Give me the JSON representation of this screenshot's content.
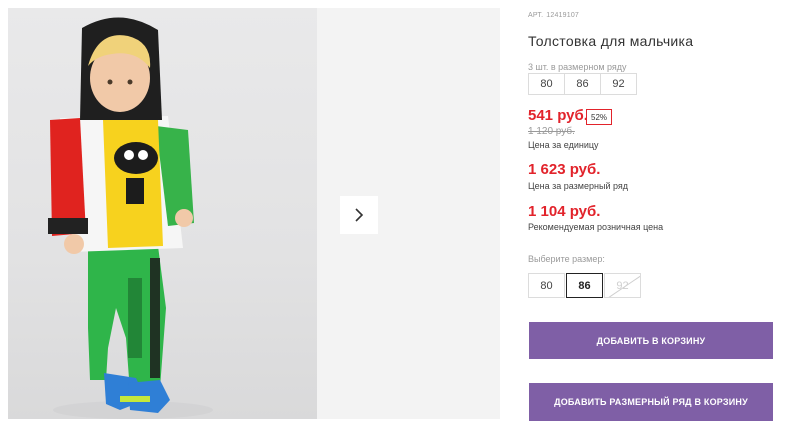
{
  "product": {
    "article_label": "АРТ.",
    "article_number": "12419107",
    "title": "Толстовка для мальчика",
    "image_alt": "Мальчик в толстовке MONSTERS и зелёных брюках"
  },
  "pack": {
    "note": "3 шт. в размерном ряду",
    "sizes": [
      "80",
      "86",
      "92"
    ]
  },
  "prices": {
    "unit_price": "541 руб.",
    "discount": "52%",
    "old_price": "1 120 руб.",
    "unit_label": "Цена за единицу",
    "row_price": "1 623 руб.",
    "row_label": "Цена за размерный ряд",
    "rrp_price": "1 104 руб.",
    "rrp_label": "Рекомендуемая розничная цена"
  },
  "size_select": {
    "label": "Выберите размер:",
    "options": [
      {
        "value": "80",
        "state": "available"
      },
      {
        "value": "86",
        "state": "selected"
      },
      {
        "value": "92",
        "state": "unavailable"
      }
    ]
  },
  "actions": {
    "add_to_cart": "ДОБАВИТЬ В КОРЗИНУ",
    "add_row_to_cart": "ДОБАВИТЬ РАЗМЕРНЫЙ РЯД В КОРЗИНУ"
  },
  "colors": {
    "accent_price": "#e2232b",
    "button": "#7f5fa6"
  },
  "icons": {
    "next": "chevron-right-icon"
  }
}
